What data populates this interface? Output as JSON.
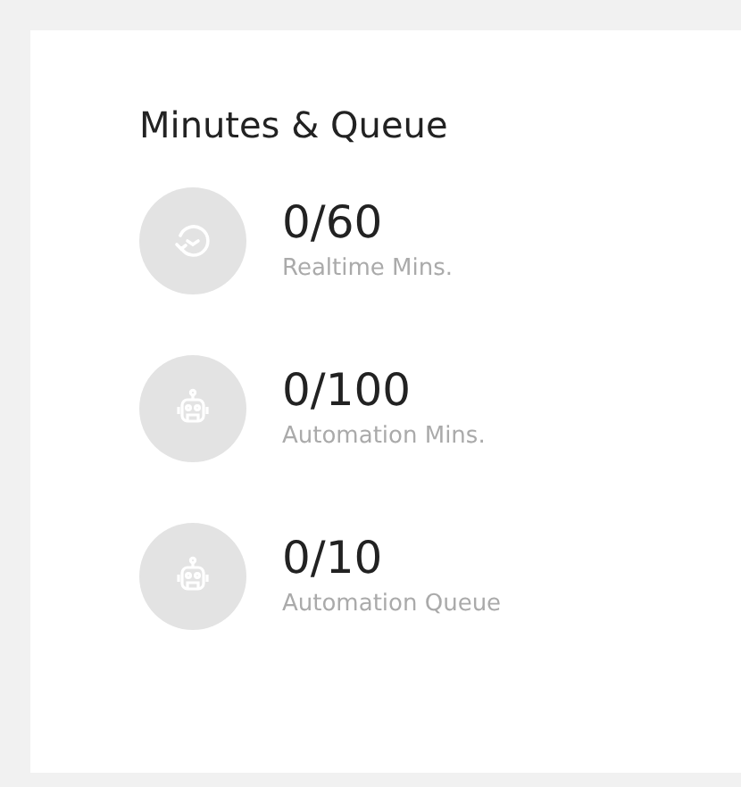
{
  "card": {
    "title": "Minutes & Queue",
    "stats": [
      {
        "kind": "clock",
        "value": "0/60",
        "label": "Realtime Mins."
      },
      {
        "kind": "robot",
        "value": "0/100",
        "label": "Automation Mins."
      },
      {
        "kind": "robot",
        "value": "0/10",
        "label": "Automation Queue"
      }
    ]
  }
}
